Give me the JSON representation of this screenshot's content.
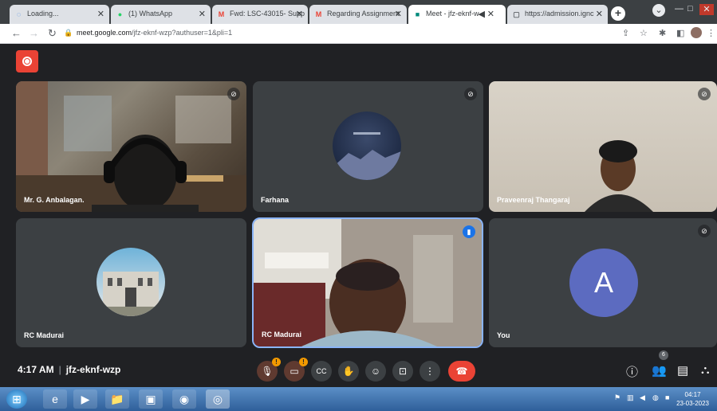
{
  "browser": {
    "tabs": [
      {
        "label": "Loading...",
        "icon": "loading-icon"
      },
      {
        "label": "(1) WhatsApp",
        "icon": "whatsapp-icon"
      },
      {
        "label": "Fwd: LSC-43015- Supp",
        "icon": "gmail-icon"
      },
      {
        "label": "Regarding Assignment",
        "icon": "gmail-icon"
      },
      {
        "label": "Meet - jfz-eknf-w",
        "icon": "meet-icon"
      },
      {
        "label": "https://admission.ignc",
        "icon": "page-icon"
      }
    ],
    "url_host": "meet.google.com",
    "url_path": "/jfz-eknf-wzp?authuser=1&pli=1"
  },
  "tiles": [
    {
      "name": "Mr. G. Anbalagan.",
      "muted": true
    },
    {
      "name": "Farhana",
      "muted": true
    },
    {
      "name": "Praveenraj Thangaraj",
      "muted": true
    },
    {
      "name": "RC Madurai",
      "muted": false
    },
    {
      "name": "RC Madurai",
      "muted": false,
      "speaking": true
    },
    {
      "name": "You",
      "muted": true,
      "avatar_letter": "A",
      "avatar_color": "#5c6bc0"
    }
  ],
  "meeting": {
    "time": "4:17 AM",
    "code": "jfz-eknf-wzp"
  },
  "controls": {
    "mic_badge": "!",
    "cam_badge": "!",
    "participants_count": "6"
  },
  "taskbar": {
    "time": "04:17",
    "date": "23-03-2023"
  }
}
